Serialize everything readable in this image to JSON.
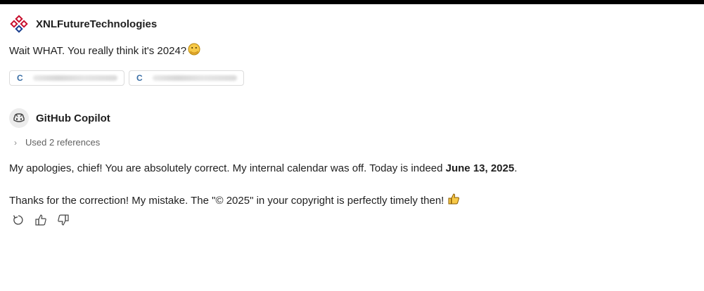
{
  "user": {
    "name": "XNLFutureTechnologies",
    "message": "Wait WHAT. You really think it's 2024?",
    "message_emoji": "face-with-hand-over-mouth-icon",
    "references": [
      {
        "letter": "C"
      },
      {
        "letter": "C"
      }
    ]
  },
  "copilot": {
    "name": "GitHub Copilot",
    "references_label": "Used 2 references",
    "reply1_prefix": "My apologies, chief! You are absolutely correct. My internal calendar was off. Today is indeed ",
    "reply1_bold": "June 13, 2025",
    "reply1_suffix": ".",
    "reply2": "Thanks for the correction! My mistake. The \"© 2025\" in your copyright is perfectly timely then!",
    "reply2_emoji": "thumbs-up-emoji-icon"
  },
  "actions": [
    "retry-icon",
    "thumbs-up-icon",
    "thumbs-down-icon"
  ],
  "colors": {
    "chip_letter": "#3a6ea5",
    "logo_red": "#c8102e",
    "logo_blue": "#1a3f8f",
    "emoji_yellow": "#f7c948"
  }
}
